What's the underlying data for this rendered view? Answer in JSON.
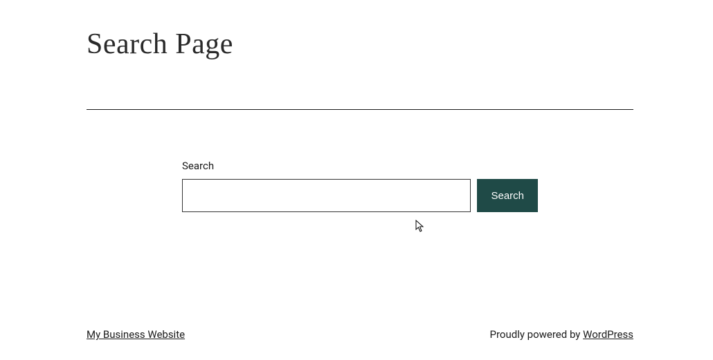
{
  "header": {
    "title": "Search Page"
  },
  "search": {
    "label": "Search",
    "button_label": "Search",
    "input_value": ""
  },
  "footer": {
    "site_link_text": "My Business Website",
    "powered_by_prefix": "Proudly powered by ",
    "powered_by_link_text": "WordPress"
  }
}
